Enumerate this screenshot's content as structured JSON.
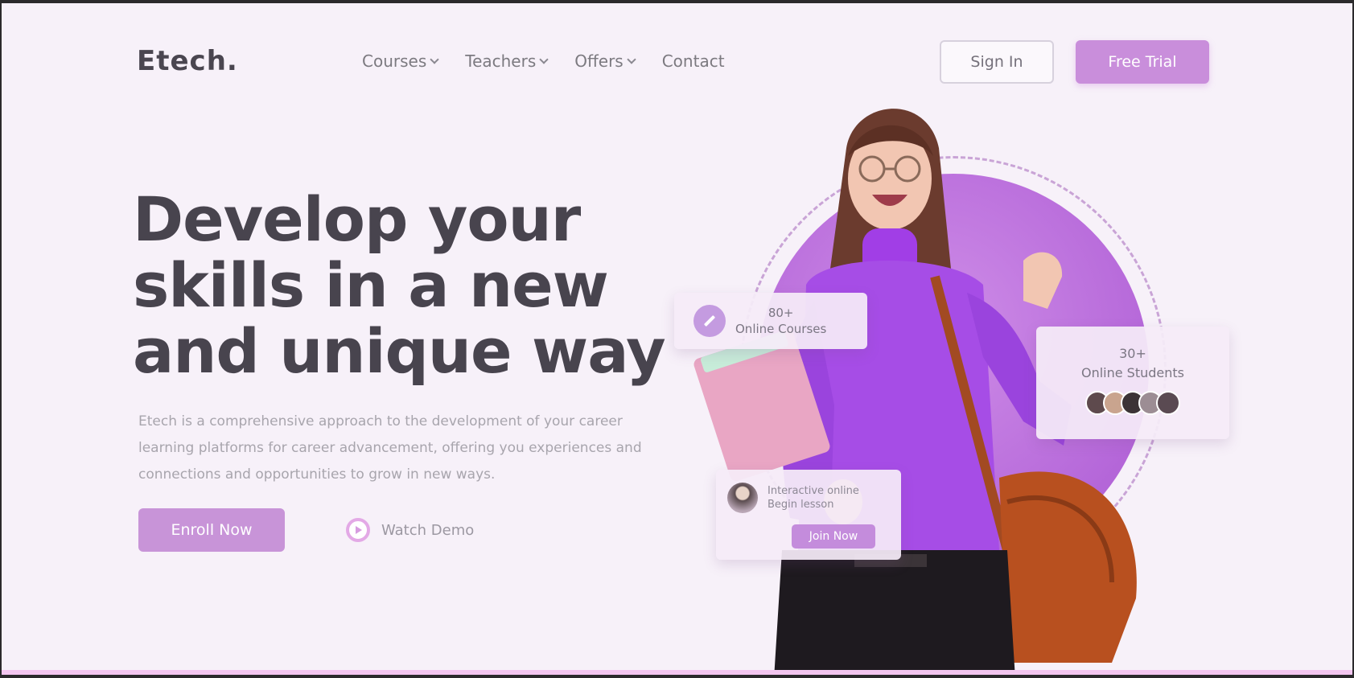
{
  "brand": {
    "logo": "Etech."
  },
  "nav": {
    "items": [
      {
        "label": "Courses",
        "dropdown": true
      },
      {
        "label": "Teachers",
        "dropdown": true
      },
      {
        "label": "Offers",
        "dropdown": true
      },
      {
        "label": "Contact",
        "dropdown": false
      }
    ],
    "signin_label": "Sign In",
    "trial_label": "Free Trial"
  },
  "hero": {
    "title_line1": "Develop your",
    "title_line2": "skills in a new",
    "title_line3": "and unique way",
    "description": "Etech is a comprehensive approach to the development of your career learning platforms for career advancement, offering you experiences and connections and opportunities to grow in new ways.",
    "enroll_label": "Enroll Now",
    "demo_label": "Watch Demo"
  },
  "cards": {
    "courses": {
      "count": "80+",
      "label": "Online Courses"
    },
    "students": {
      "count": "30+",
      "label": "Online Students"
    },
    "class": {
      "title": "Interactive online",
      "subtitle": "Begin lesson",
      "button": "Join Now"
    }
  },
  "colors": {
    "accent": "#c98edb",
    "purple": "#a64de6",
    "page_bg": "#f7f1f9",
    "text_dark": "#48444e"
  }
}
